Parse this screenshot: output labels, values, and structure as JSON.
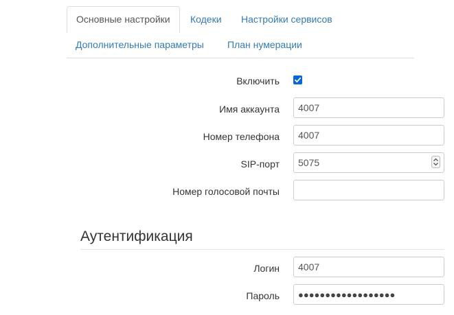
{
  "tabs": {
    "basic": "Основные настройки",
    "codecs": "Кодеки",
    "services": "Настройки сервисов",
    "advanced": "Дополнительные параметры",
    "dialplan": "План нумерации"
  },
  "account": {
    "enable_label": "Включить",
    "enable_checked": true,
    "account_name_label": "Имя аккаунта",
    "account_name_value": "4007",
    "phone_number_label": "Номер телефона",
    "phone_number_value": "4007",
    "sip_port_label": "SIP-порт",
    "sip_port_value": "5075",
    "voicemail_label": "Номер голосовой почты",
    "voicemail_value": ""
  },
  "auth": {
    "title": "Аутентификация",
    "login_label": "Логин",
    "login_value": "4007",
    "password_label": "Пароль",
    "password_mask": "●●●●●●●●●●●●●●●●●●"
  },
  "colors": {
    "link": "#337ab7",
    "checkbox": "#0a66d8",
    "border": "#cccccc"
  }
}
